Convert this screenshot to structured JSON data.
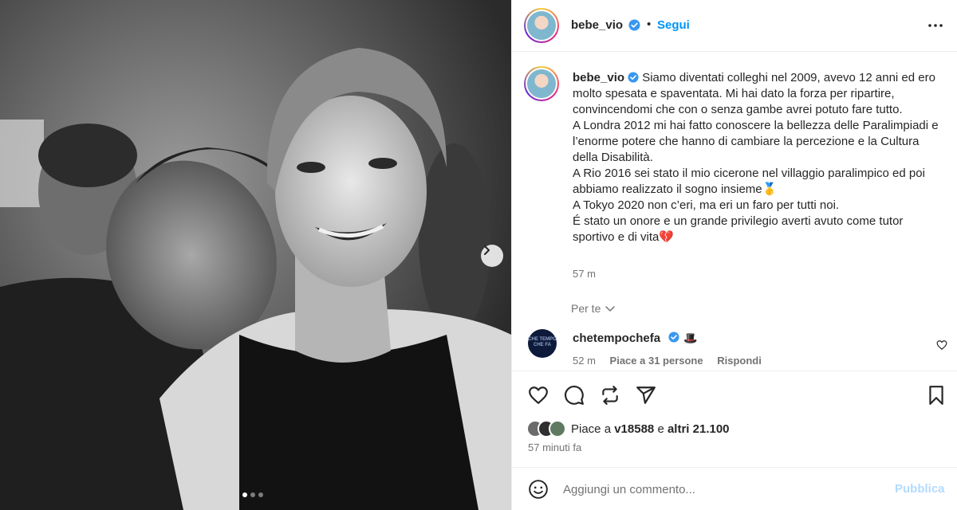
{
  "post": {
    "author": "bebe_vio",
    "follow_label": "Segui",
    "separator": "•",
    "caption_lines": [
      "Siamo diventati colleghi nel 2009, avevo 12 anni ed ero molto spesata e spaventata. Mi hai dato la forza per ripartire, convincendomi che con o senza gambe avrei potuto fare tutto.",
      "A Londra 2012 mi hai fatto conoscere la bellezza delle Paralimpiadi e l’enorme potere che hanno di cambiare la percezione e la Cultura della Disabilità.",
      "A Rio 2016 sei stato il mio cicerone nel villaggio paralimpico ed poi abbiamo realizzato il sogno insieme🥇",
      "A Tokyo 2020 non c’eri, ma eri un faro per tutti noi.",
      "É stato un onore e un grande privilegio averti avuto come tutor sportivo e di vita💔"
    ],
    "caption_time": "57 m",
    "for_you_label": "Per te",
    "carousel": {
      "total": 3,
      "active_index": 0
    }
  },
  "comment": {
    "author": "chetempochefa",
    "avatar_text": "CHE TEMPO CHE FA",
    "emoji": "🎩",
    "time": "52 m",
    "likes_label": "Piace a 31 persone",
    "reply_label": "Rispondi"
  },
  "actions": {
    "likes_prefix": "Piace a",
    "liker": "v18588",
    "likes_conj": "e",
    "likes_others": "altri 21.100",
    "posted_ago": "57 minuti fa"
  },
  "add_comment": {
    "placeholder": "Aggiungi un commento...",
    "publish_label": "Pubblica"
  },
  "colors": {
    "link_blue": "#0095f6",
    "publish_disabled": "#b3dbff",
    "verified_blue": "#3897f0",
    "secondary_text": "#737373"
  }
}
